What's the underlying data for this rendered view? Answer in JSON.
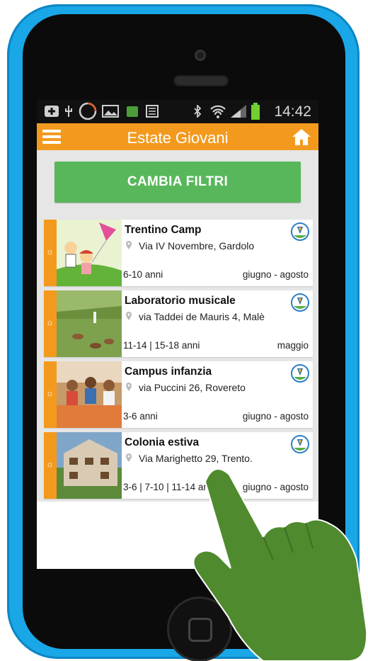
{
  "statusbar": {
    "time": "14:42"
  },
  "appbar": {
    "title": "Estate Giovani"
  },
  "filter_button": {
    "label": "CAMBIA FILTRI"
  },
  "events": [
    {
      "name": "Trentino Camp",
      "address": "Via IV Novembre, Gardolo",
      "ages": "6-10 anni",
      "period": "giugno - agosto"
    },
    {
      "name": "Laboratorio musicale",
      "address": "via Taddei de Mauris 4, Malè",
      "ages": "11-14 | 15-18 anni",
      "period": "maggio"
    },
    {
      "name": "Campus infanzia",
      "address": "via Puccini 26, Rovereto",
      "ages": "3-6 anni",
      "period": "giugno - agosto"
    },
    {
      "name": "Colonia estiva",
      "address": "Via Marighetto 29, Trento.",
      "ages": "3-6 | 7-10 | 11-14 anni",
      "period": "giugno - agosto"
    }
  ],
  "colors": {
    "accent": "#f39a1e",
    "button": "#59b75b",
    "phone": "#1aa7e8"
  }
}
